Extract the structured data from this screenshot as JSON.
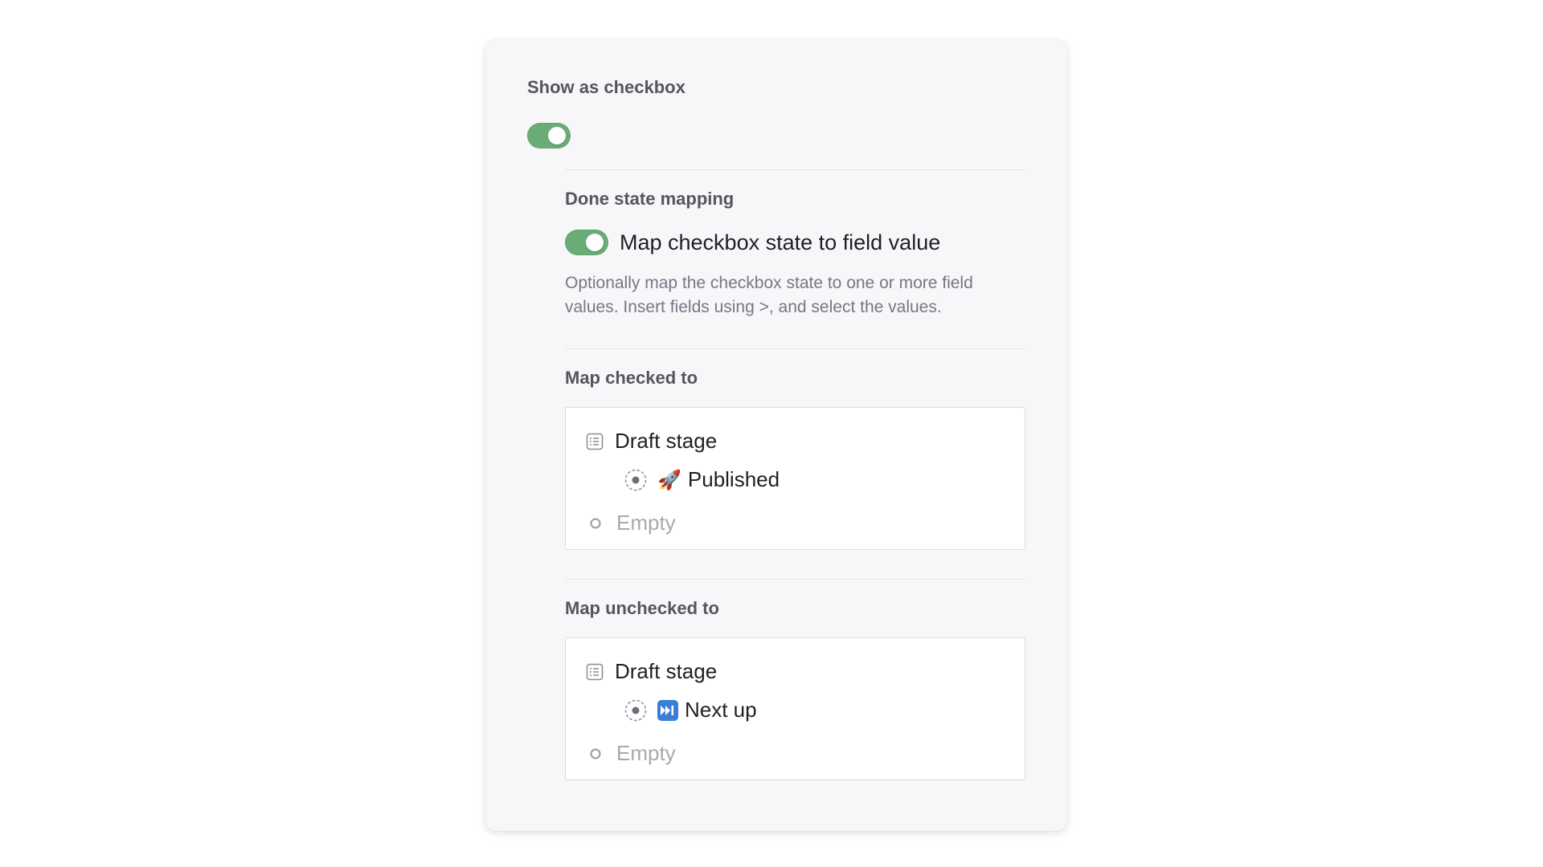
{
  "show_checkbox": {
    "label": "Show as checkbox",
    "enabled": true
  },
  "done_state": {
    "label": "Done state mapping",
    "toggle_label": "Map checkbox state to field value",
    "toggle_enabled": true,
    "description": "Optionally map the checkbox state to one or more field values. Insert fields using >, and select the values."
  },
  "map_checked": {
    "label": "Map checked to",
    "field_name": "Draft stage",
    "field_icon": "list-icon",
    "value_icon": "rocket-emoji",
    "value_emoji": "🚀",
    "value_label": "Published",
    "empty_label": "Empty"
  },
  "map_unchecked": {
    "label": "Map unchecked to",
    "field_name": "Draft stage",
    "field_icon": "list-icon",
    "value_icon": "fast-forward-emoji",
    "value_label": "Next up",
    "empty_label": "Empty"
  },
  "colors": {
    "toggle_on": "#6aac78",
    "panel_bg": "#f7f7f9",
    "muted_text": "#777785",
    "placeholder_text": "#a8a8b2"
  }
}
